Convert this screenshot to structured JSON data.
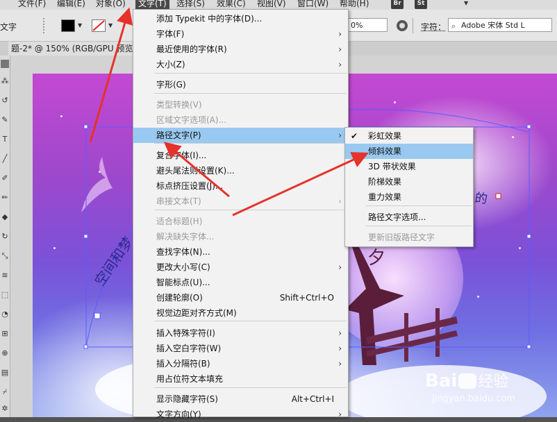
{
  "menubar": {
    "items": [
      {
        "label": "文件(F)"
      },
      {
        "label": "编辑(E)"
      },
      {
        "label": "对象(O)"
      },
      {
        "label": "文字(T)"
      },
      {
        "label": "选择(S)"
      },
      {
        "label": "效果(C)"
      },
      {
        "label": "视图(V)"
      },
      {
        "label": "窗口(W)"
      },
      {
        "label": "帮助(H)"
      }
    ],
    "badges": [
      "Br",
      "St"
    ]
  },
  "controlbar": {
    "left_label": "文字",
    "percent_value": "0%",
    "char_label": "字符：",
    "font_field": "Adobe 宋体 Std L"
  },
  "doc_tab": {
    "title": "题-2* @ 150% (RGB/GPU 预览"
  },
  "canvas": {
    "path_text_left": "空间和梦",
    "path_text_right": "的",
    "moon_text": "夕"
  },
  "type_menu": {
    "items": [
      {
        "label": "添加 Typekit 中的字体(D)...",
        "shortcut": "",
        "submenu": false,
        "disabled": false
      },
      {
        "label": "字体(F)",
        "shortcut": "",
        "submenu": true,
        "disabled": false
      },
      {
        "label": "最近使用的字体(R)",
        "shortcut": "",
        "submenu": true,
        "disabled": false
      },
      {
        "label": "大小(Z)",
        "shortcut": "",
        "submenu": true,
        "disabled": false
      },
      {
        "label": "字形(G)",
        "shortcut": "",
        "submenu": false,
        "disabled": false
      },
      {
        "label": "类型转换(V)",
        "shortcut": "",
        "submenu": false,
        "disabled": true
      },
      {
        "label": "区域文字选项(A)...",
        "shortcut": "",
        "submenu": false,
        "disabled": true
      },
      {
        "label": "路径文字(P)",
        "shortcut": "",
        "submenu": true,
        "disabled": false,
        "highlighted": true
      },
      {
        "label": "复合字体(I)...",
        "shortcut": "",
        "submenu": false,
        "disabled": false
      },
      {
        "label": "避头尾法则设置(K)...",
        "shortcut": "",
        "submenu": false,
        "disabled": false
      },
      {
        "label": "标点挤压设置(J)...",
        "shortcut": "",
        "submenu": false,
        "disabled": false
      },
      {
        "label": "串接文本(T)",
        "shortcut": "",
        "submenu": true,
        "disabled": true
      },
      {
        "label": "适合标题(H)",
        "shortcut": "",
        "submenu": false,
        "disabled": true
      },
      {
        "label": "解决缺失字体...",
        "shortcut": "",
        "submenu": false,
        "disabled": true
      },
      {
        "label": "查找字体(N)...",
        "shortcut": "",
        "submenu": false,
        "disabled": false
      },
      {
        "label": "更改大小写(C)",
        "shortcut": "",
        "submenu": true,
        "disabled": false
      },
      {
        "label": "智能标点(U)...",
        "shortcut": "",
        "submenu": false,
        "disabled": false
      },
      {
        "label": "创建轮廓(O)",
        "shortcut": "Shift+Ctrl+O",
        "submenu": false,
        "disabled": false
      },
      {
        "label": "视觉边距对齐方式(M)",
        "shortcut": "",
        "submenu": false,
        "disabled": false
      },
      {
        "label": "插入特殊字符(I)",
        "shortcut": "",
        "submenu": true,
        "disabled": false
      },
      {
        "label": "插入空白字符(W)",
        "shortcut": "",
        "submenu": true,
        "disabled": false
      },
      {
        "label": "插入分隔符(B)",
        "shortcut": "",
        "submenu": true,
        "disabled": false
      },
      {
        "label": "用占位符文本填充",
        "shortcut": "",
        "submenu": false,
        "disabled": false
      },
      {
        "label": "显示隐藏字符(S)",
        "shortcut": "Alt+Ctrl+I",
        "submenu": false,
        "disabled": false
      },
      {
        "label": "文字方向(Y)",
        "shortcut": "",
        "submenu": true,
        "disabled": false
      }
    ]
  },
  "path_type_submenu": {
    "items": [
      {
        "label": "彩虹效果",
        "checked": true,
        "disabled": false
      },
      {
        "label": "倾斜效果",
        "checked": false,
        "disabled": false,
        "highlighted": true
      },
      {
        "label": "3D 带状效果",
        "checked": false,
        "disabled": false
      },
      {
        "label": "阶梯效果",
        "checked": false,
        "disabled": false
      },
      {
        "label": "重力效果",
        "checked": false,
        "disabled": false
      },
      {
        "label": "路径文字选项...",
        "checked": false,
        "disabled": false
      },
      {
        "label": "更新旧版路径文字",
        "checked": false,
        "disabled": true
      }
    ]
  },
  "icons": {
    "checkmark": "✔",
    "submenu_arrow": "›"
  },
  "watermark": {
    "logo": "Bai",
    "logo_tail": "经验",
    "url": "jingyan.baidu.com"
  },
  "colors": {
    "highlight": "#99c9f0",
    "annotation_arrow": "#e5322b",
    "selection_path": "#5b5bff"
  }
}
